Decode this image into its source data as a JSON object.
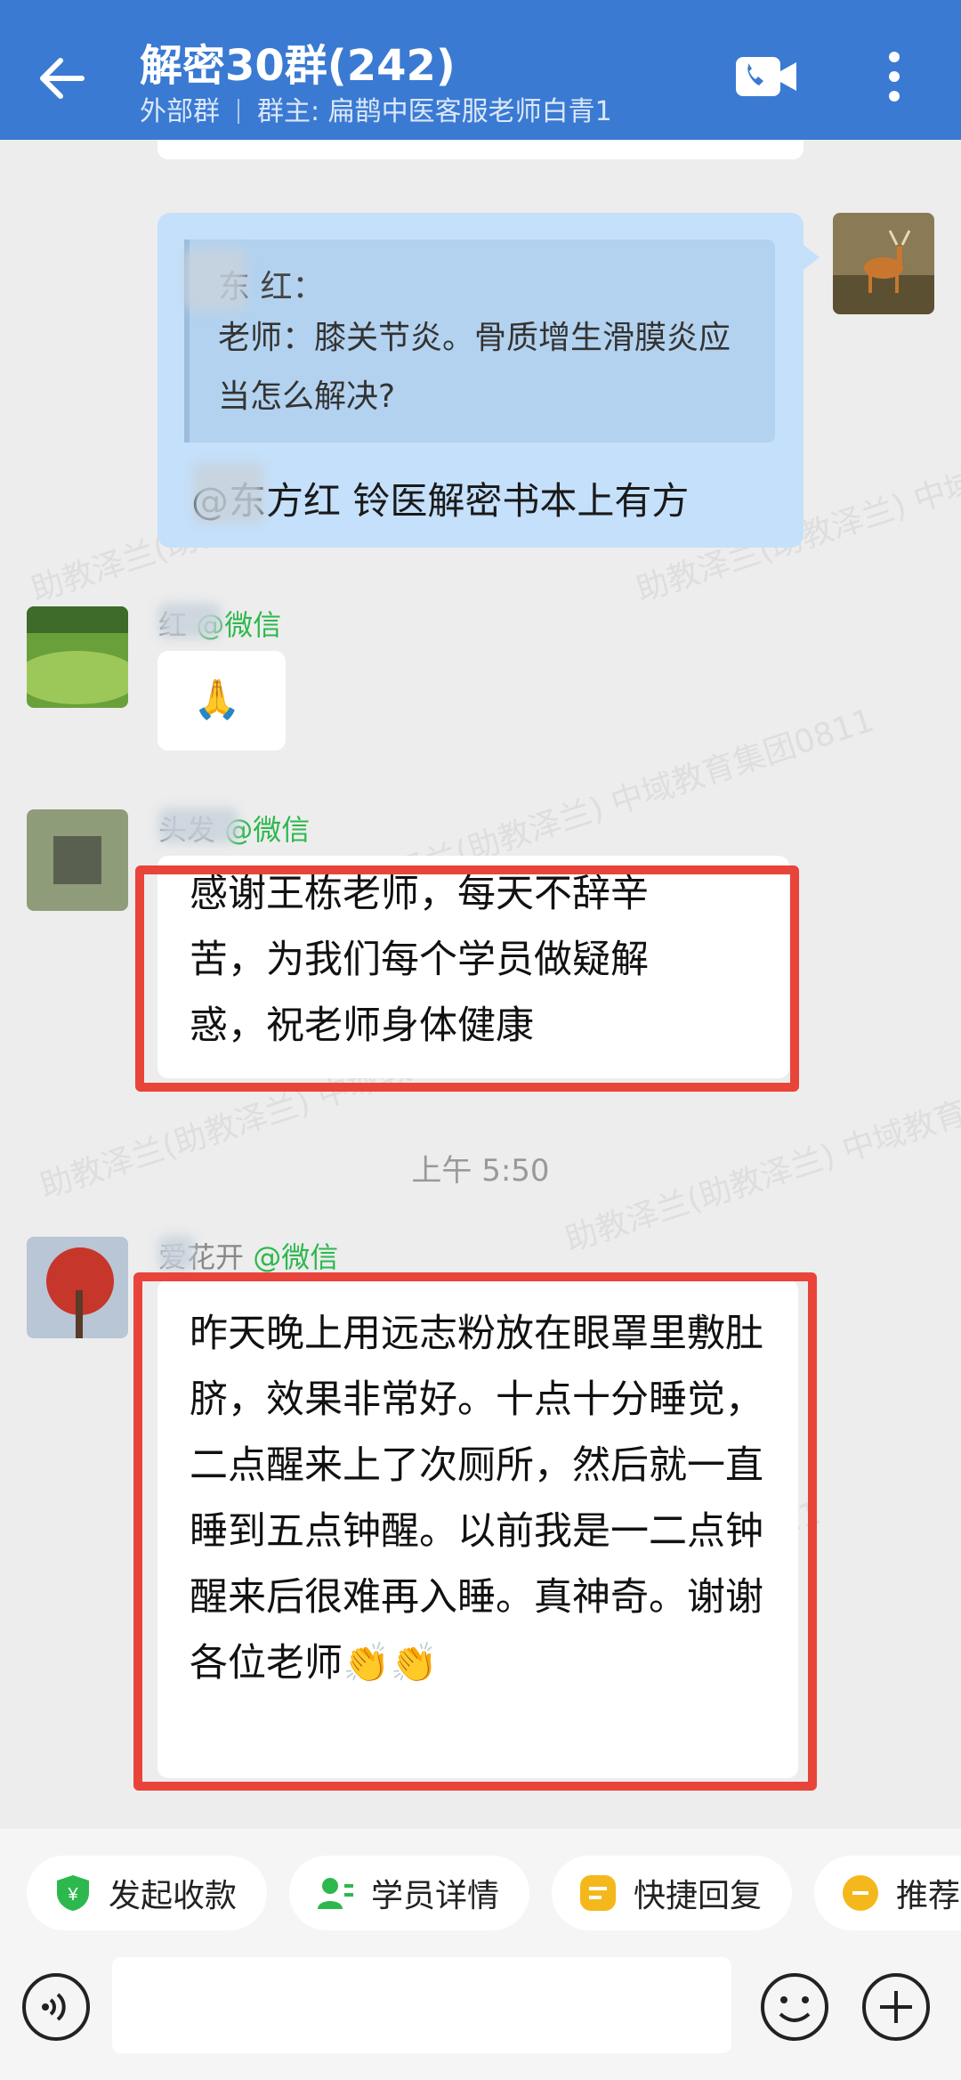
{
  "header": {
    "title": "解密30群(242)",
    "group_type": "外部群",
    "owner": "群主: 扁鹊中医客服老师白青1"
  },
  "messages": {
    "self_quote_sender": "东    红：",
    "self_quote_text": "老师：膝关节炎。骨质增生滑膜炎应当怎么解决?",
    "self_reply": "@东方红  铃医解密书本上有方",
    "m1_sender": "红",
    "m1_tag": "@微信",
    "m1_text": "🙏",
    "m2_sender": "头发",
    "m2_tag": "@微信",
    "m2_text": "感谢王栋老师，每天不辞辛苦，为我们每个学员做疑解惑，祝老师身体健康",
    "time": "上午 5:50",
    "m3_sender": "爱花开",
    "m3_tag": "@微信",
    "m3_text": "昨天晚上用远志粉放在眼罩里敷肚脐，效果非常好。十点十分睡觉，二点醒来上了次厕所，然后就一直睡到五点钟醒。以前我是一二点钟醒来后很难再入睡。真神奇。谢谢各位老师👏👏"
  },
  "watermarks": [
    "助教泽兰(助教泽兰) 中域教育集团0811"
  ],
  "toolbar": {
    "collect_label": "发起收款",
    "student_label": "学员详情",
    "quick_label": "快捷回复",
    "recommend_label": "推荐"
  },
  "colors": {
    "header_bg": "#3a7ad2",
    "self_bubble": "#c5e0fb",
    "tag_green": "#2db84d",
    "highlight_red": "#e8443a"
  }
}
